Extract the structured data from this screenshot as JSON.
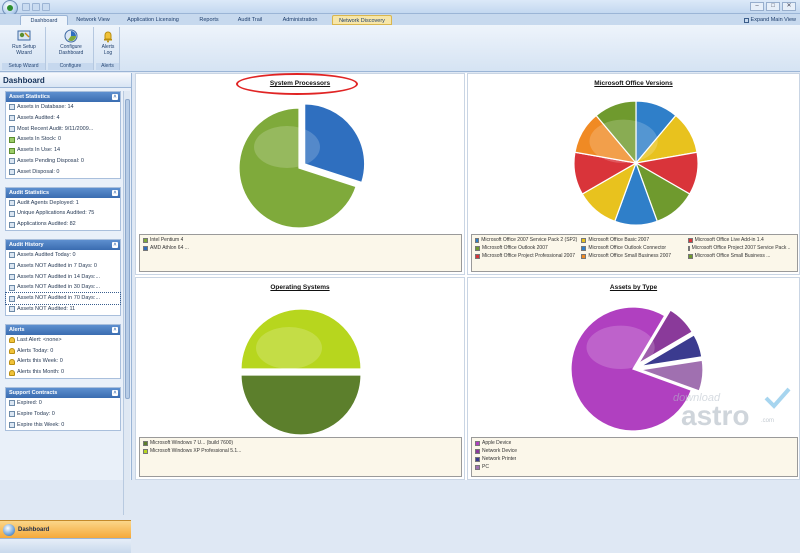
{
  "window": {
    "title": "",
    "controls": {
      "minimize": "–",
      "maximize": "□",
      "close": "✕"
    }
  },
  "tabs": [
    {
      "label": "Dashboard",
      "active": true
    },
    {
      "label": "Network View"
    },
    {
      "label": "Application Licensing"
    },
    {
      "label": "Reports"
    },
    {
      "label": "Audit Trail"
    },
    {
      "label": "Administration"
    },
    {
      "label": "Network Discovery",
      "contextual": true
    }
  ],
  "expand_label": "Expand Main View",
  "ribbon": {
    "groups": [
      {
        "label": "Setup Wizard",
        "buttons": [
          {
            "label1": "Run Setup",
            "label2": "Wizard",
            "icon": "wizard-icon"
          }
        ]
      },
      {
        "label": "Configure",
        "buttons": [
          {
            "label1": "Configure",
            "label2": "Dashboard",
            "icon": "configure-dashboard-icon"
          }
        ]
      },
      {
        "label": "Alerts",
        "buttons": [
          {
            "label1": "Alerts",
            "label2": "Log",
            "icon": "alerts-log-icon"
          }
        ]
      }
    ]
  },
  "sidebar": {
    "title": "Dashboard",
    "sections": [
      {
        "title": "Asset Statistics",
        "items": [
          {
            "text": "Assets in Database: 14",
            "icon": "asset"
          },
          {
            "text": "Assets Audited: 4",
            "icon": "asset"
          },
          {
            "text": "Most Recent Audit: 9/11/2009...",
            "icon": "asset"
          },
          {
            "text": "Assets In Stock: 0",
            "icon": "green"
          },
          {
            "text": "Assets In Use: 14",
            "icon": "green"
          },
          {
            "text": "Assets Pending Disposal: 0",
            "icon": "asset"
          },
          {
            "text": "Asset Disposal: 0",
            "icon": "asset"
          }
        ]
      },
      {
        "title": "Audit Statistics",
        "items": [
          {
            "text": "Audit Agents Deployed: 1",
            "icon": "asset"
          },
          {
            "text": "Unique Applications Audited: 75",
            "icon": "asset"
          },
          {
            "text": "Applications Audited: 82",
            "icon": "asset"
          }
        ]
      },
      {
        "title": "Audit History",
        "items": [
          {
            "text": "Assets Audited Today: 0",
            "icon": "asset"
          },
          {
            "text": "Assets NOT Audited in 7 Days: 0",
            "icon": "asset"
          },
          {
            "text": "Assets NOT Audited in 14 Days:...",
            "icon": "asset"
          },
          {
            "text": "Assets NOT Audited in 30 Days:...",
            "icon": "asset"
          },
          {
            "text": "Assets NOT Audited in 70 Days:...",
            "icon": "asset",
            "selected": true
          },
          {
            "text": "Assets NOT Audited: 11",
            "icon": "asset"
          }
        ]
      },
      {
        "title": "Alerts",
        "items": [
          {
            "text": "Last Alert: <none>",
            "icon": "bell"
          },
          {
            "text": "Alerts Today: 0",
            "icon": "bell"
          },
          {
            "text": "Alerts this Week: 0",
            "icon": "bell"
          },
          {
            "text": "Alerts this Month: 0",
            "icon": "bell"
          }
        ]
      },
      {
        "title": "Support Contracts",
        "items": [
          {
            "text": "Expired: 0",
            "icon": "asset"
          },
          {
            "text": "Expire Today: 0",
            "icon": "asset"
          },
          {
            "text": "Expire this Week: 0",
            "icon": "asset"
          }
        ]
      }
    ],
    "nav_label": "Dashboard"
  },
  "chart_data": [
    {
      "type": "pie",
      "title": "System Processors",
      "categories": [
        "Intel Pentium 4",
        "AMD Athlon 64 ..."
      ],
      "values": [
        70,
        30
      ],
      "colors": [
        "#7faa3b",
        "#2f6fbf"
      ],
      "exploded": [
        false,
        true
      ]
    },
    {
      "type": "pie",
      "title": "Microsoft Office Versions",
      "categories": [
        "Microsoft Office 2007 Service Pack 2 (SP2)",
        "Microsoft Office Basic 2007",
        "Microsoft Office Live Add-in 1.4",
        "Microsoft Office Outlook 2007",
        "Microsoft Office Outlook Connector",
        "Microsoft Office Project 2007 Service Pack ...",
        "Microsoft Office Project Professional 2007",
        "Microsoft Office Small Business 2007",
        "Microsoft Office Small Business ..."
      ],
      "values": [
        1,
        1,
        1,
        1,
        1,
        1,
        1,
        1,
        1
      ],
      "colors": [
        "#2f7fc9",
        "#e8c21e",
        "#d9343a",
        "#6f9a2e",
        "#2f7fc9",
        "#e8c21e",
        "#d9343a",
        "#f08a24",
        "#6f9a2e"
      ]
    },
    {
      "type": "pie",
      "title": "Operating Systems",
      "categories": [
        "Microsoft Windows 7 U... (build 7600)",
        "Microsoft Windows XP Professional 5.1..."
      ],
      "values": [
        50,
        50
      ],
      "colors": [
        "#5c7f2c",
        "#b7d61e"
      ],
      "exploded": [
        true,
        false
      ]
    },
    {
      "type": "pie",
      "title": "Assets by Type",
      "categories": [
        "Apple Device",
        "Network Device",
        "Network Printer",
        "PC"
      ],
      "values": [
        78,
        8,
        6,
        8
      ],
      "colors": [
        "#b040c0",
        "#8a3a9a",
        "#3b3b8f",
        "#a070b0"
      ],
      "exploded": [
        false,
        true,
        true,
        true
      ]
    }
  ],
  "watermark": {
    "line1": "download",
    "line2": "astro",
    "line3": ".com"
  }
}
